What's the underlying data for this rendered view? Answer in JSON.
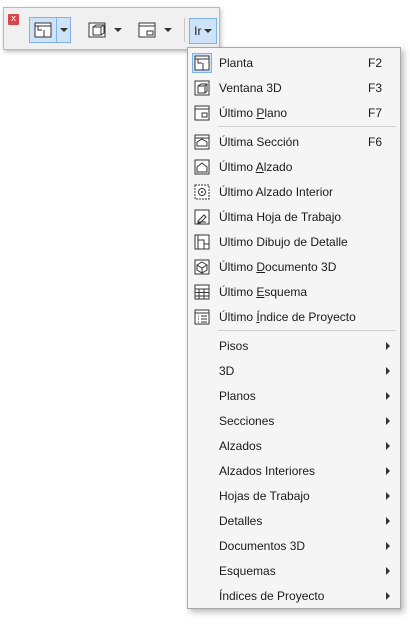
{
  "toolbar": {
    "close_glyph": "x",
    "ir_label": "Ir",
    "buttons": [
      {
        "icon": "floor-plan-icon"
      },
      {
        "icon": "3d-window-icon"
      },
      {
        "icon": "last-layout-icon"
      }
    ]
  },
  "menu": {
    "items": [
      {
        "label": "Planta",
        "shortcut": "F2",
        "icon": "floor-plan-icon"
      },
      {
        "label": "Ventana 3D",
        "shortcut": "F3",
        "icon": "3d-window-icon"
      },
      {
        "label": "Último Plano",
        "shortcut": "F7",
        "icon": "layout-icon"
      },
      {
        "label": "Última Sección",
        "shortcut": "F6",
        "icon": "section-icon"
      },
      {
        "label": "Último Alzado",
        "shortcut": "",
        "icon": "elevation-icon"
      },
      {
        "label": "Último Alzado Interior",
        "shortcut": "",
        "icon": "interior-elevation-icon"
      },
      {
        "label": "Última Hoja de Trabajo",
        "shortcut": "",
        "icon": "worksheet-icon"
      },
      {
        "label": "Ultimo Dibujo de Detalle",
        "shortcut": "",
        "icon": "detail-icon"
      },
      {
        "label": "Último Documento 3D",
        "shortcut": "",
        "icon": "3d-document-icon"
      },
      {
        "label": "Último Esquema",
        "shortcut": "",
        "icon": "schedule-icon"
      },
      {
        "label": "Último Índice de Proyecto",
        "shortcut": "",
        "icon": "project-index-icon"
      }
    ],
    "submenus": [
      "Pisos",
      "3D",
      "Planos",
      "Secciones",
      "Alzados",
      "Alzados Interiores",
      "Hojas de Trabajo",
      "Detalles",
      "Documentos 3D",
      "Esquemas",
      "Índices de Proyecto"
    ]
  },
  "colors": {
    "accent_selected_bg": "#cfe3f8",
    "accent_selected_border": "#7fb2e6",
    "close_red": "#d8454a"
  }
}
